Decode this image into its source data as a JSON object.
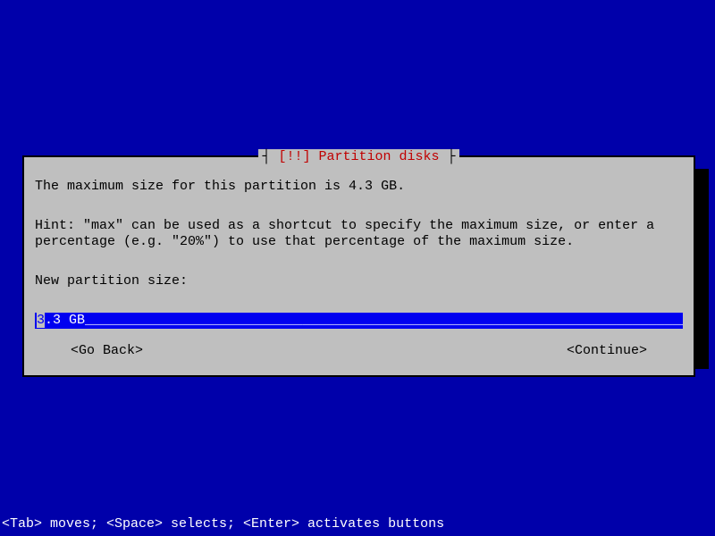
{
  "dialog": {
    "title_prefix": "[!!] ",
    "title_main": "Partition disks",
    "info": "The maximum size for this partition is 4.3 GB.",
    "hint": "Hint: \"max\" can be used as a shortcut to specify the maximum size, or enter a percentage (e.g. \"20%\") to use that percentage of the maximum size.",
    "prompt": "New partition size:",
    "input_value": "3.3 GB",
    "go_back": "<Go Back>",
    "continue": "<Continue>"
  },
  "footer": "<Tab> moves; <Space> selects; <Enter> activates buttons"
}
